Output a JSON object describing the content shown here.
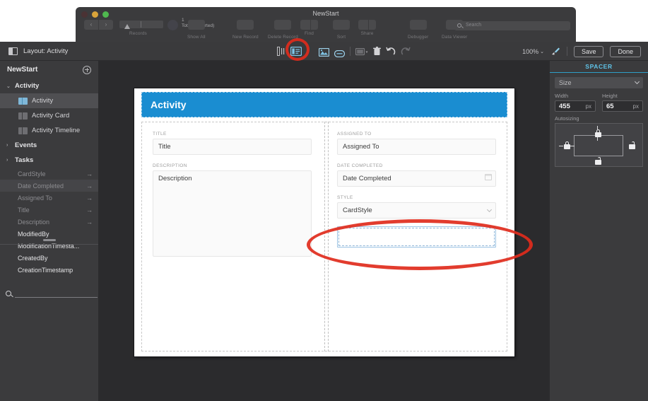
{
  "window": {
    "title": "NewStart",
    "traffic_lights": [
      "close",
      "minimize",
      "zoom"
    ]
  },
  "record_toolbar": {
    "nav_prev": "‹",
    "nav_next": "›",
    "records_label": "Records",
    "record_count": "1",
    "record_status": "Total (Unsorted)",
    "show_all_label": "Show All",
    "new_record_label": "New Record",
    "delete_record_label": "Delete Record",
    "find_label": "Find",
    "sort_label": "Sort",
    "share_label": "Share",
    "debugger_label": "Debugger",
    "data_viewer_label": "Data Viewer",
    "search_placeholder": "Search"
  },
  "layout_bar": {
    "mode_label": "Layout: Activity",
    "zoom_level": "100%",
    "save_label": "Save",
    "done_label": "Done",
    "icons": [
      "layout-mode-icon",
      "field-picker-icon",
      "inspector-icon",
      "media-icon",
      "button-bar-icon",
      "theme-icon",
      "trash-icon",
      "undo-icon",
      "redo-icon",
      "format-painter-icon"
    ]
  },
  "sidebar": {
    "title": "NewStart",
    "add_button": "add-layout-icon",
    "groups": [
      {
        "label": "Activity",
        "expanded": true,
        "items": [
          {
            "label": "Activity",
            "selected": true
          },
          {
            "label": "Activity Card",
            "selected": false
          },
          {
            "label": "Activity Timeline",
            "selected": false
          }
        ]
      },
      {
        "label": "Events",
        "expanded": false,
        "items": []
      },
      {
        "label": "Tasks",
        "expanded": false,
        "items": []
      }
    ],
    "field_search": {
      "value": "",
      "placeholder": ""
    },
    "field_tools": [
      "add-field-icon",
      "edit-field-icon",
      "delete-field-icon"
    ],
    "fields": [
      {
        "name": "CardStyle",
        "dim": true,
        "arrow": "→",
        "highlight": false
      },
      {
        "name": "Date Completed",
        "dim": true,
        "arrow": "→",
        "highlight": true
      },
      {
        "name": "Assigned To",
        "dim": true,
        "arrow": "→",
        "highlight": false
      },
      {
        "name": "Title",
        "dim": true,
        "arrow": "→",
        "highlight": false
      },
      {
        "name": "Description",
        "dim": true,
        "arrow": "→",
        "highlight": false
      },
      {
        "name": "ModifiedBy",
        "dim": false,
        "arrow": "",
        "highlight": false
      },
      {
        "name": "ModificationTimesta...",
        "dim": false,
        "arrow": "",
        "highlight": false
      },
      {
        "name": "CreatedBy",
        "dim": false,
        "arrow": "",
        "highlight": false
      },
      {
        "name": "CreationTimestamp",
        "dim": false,
        "arrow": "",
        "highlight": false
      }
    ]
  },
  "layout_canvas": {
    "header_title": "Activity",
    "header_color": "#1a8dd1",
    "left_column": [
      {
        "label": "TITLE",
        "value": "Title",
        "type": "text"
      },
      {
        "label": "DESCRIPTION",
        "value": "Description",
        "type": "textarea"
      }
    ],
    "right_column": [
      {
        "label": "ASSIGNED TO",
        "value": "Assigned To",
        "type": "text"
      },
      {
        "label": "DATE COMPLETED",
        "value": "Date Completed",
        "type": "date"
      },
      {
        "label": "STYLE",
        "value": "CardStyle",
        "type": "select"
      }
    ],
    "selected_object": {
      "name": "spacer",
      "value": ""
    }
  },
  "inspector": {
    "title": "SPACER",
    "section_label": "Size",
    "width_label": "Width",
    "width_value": "455",
    "width_unit": "px",
    "height_label": "Height",
    "height_value": "65",
    "height_unit": "px",
    "autosizing_label": "Autosizing",
    "anchors": {
      "top": "locked",
      "left": "locked",
      "right": "unlocked",
      "bottom": "unlocked"
    }
  },
  "annotations": {
    "color": "#e02b1c",
    "marks": [
      {
        "shape": "circle",
        "target": "inspector-toggle-icon"
      },
      {
        "shape": "ellipse",
        "target": "selected-spacer-object"
      }
    ]
  }
}
